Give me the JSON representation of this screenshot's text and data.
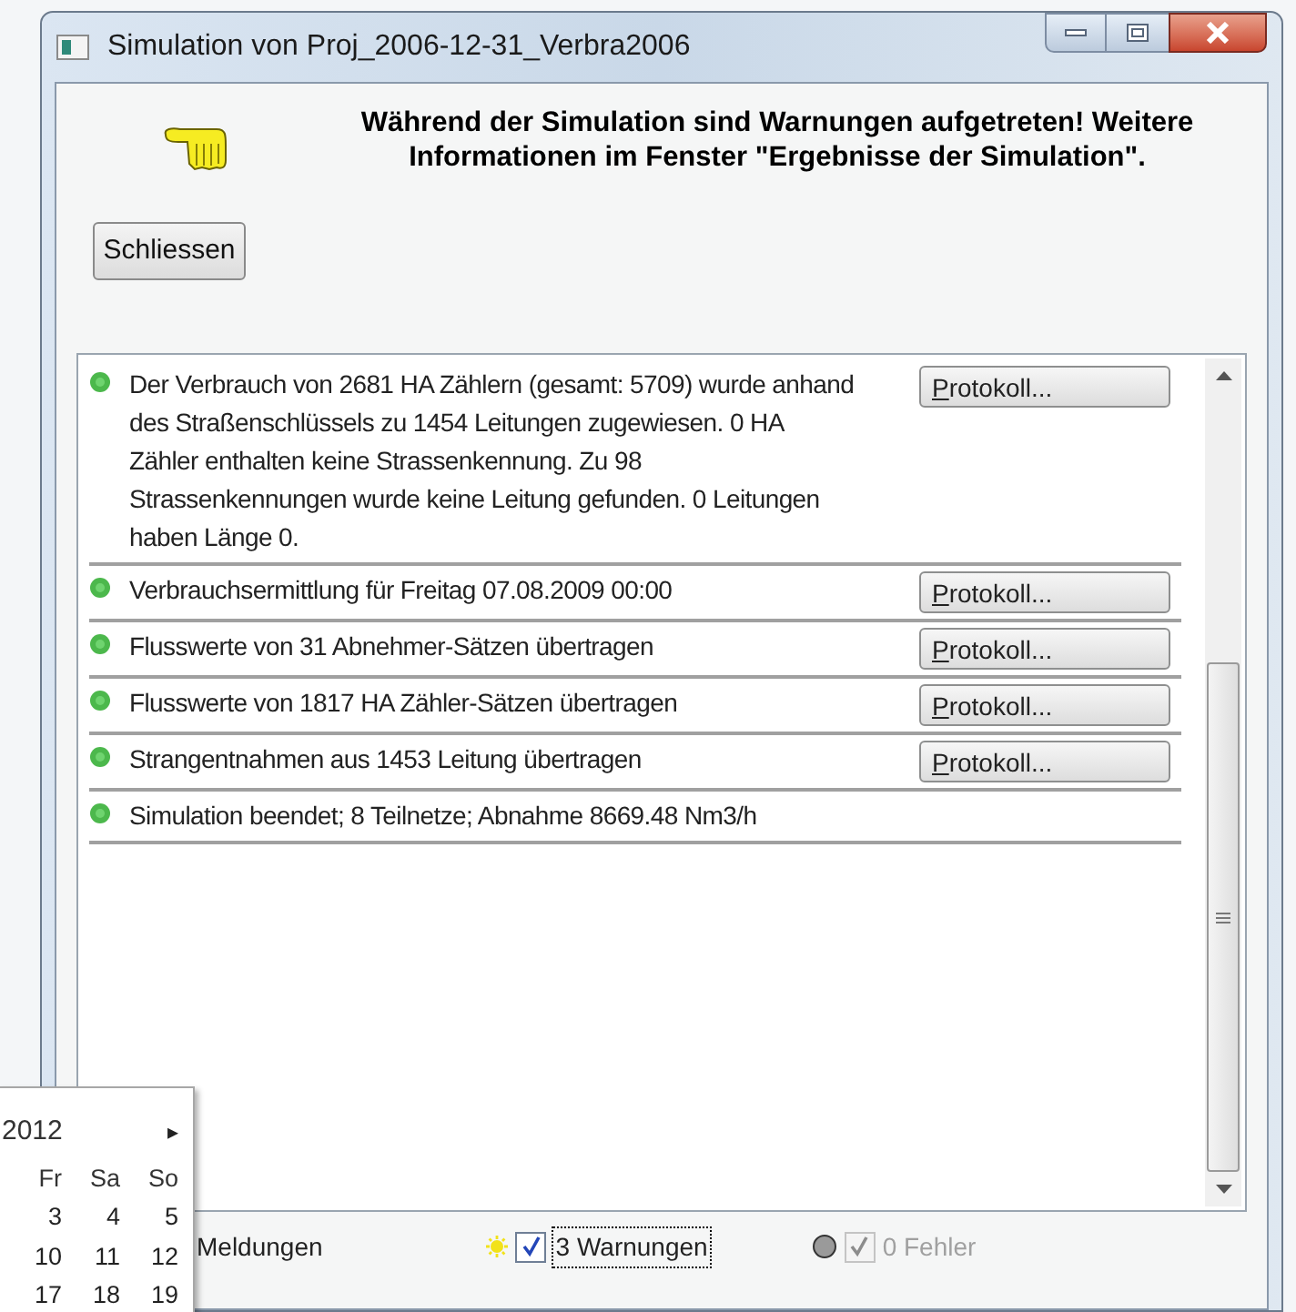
{
  "window": {
    "title": "Simulation von Proj_2006-12-31_Verbra2006"
  },
  "message": "Während der Simulation sind Warnungen aufgetreten! Weitere Informationen im Fenster \"Ergebnisse der Simulation\".",
  "close_button": "Schliessen",
  "messages": [
    {
      "text": "Der Verbrauch von 2681 HA Zählern (gesamt: 5709) wurde anhand des Straßenschlüssels zu 1454 Leitungen zugewiesen. 0 HA Zähler enthalten keine Strassenkennung. Zu 98 Strassenkennungen wurde keine Leitung gefunden. 0 Leitungen haben Länge 0.",
      "button": "Protokoll..."
    },
    {
      "text": "Verbrauchsermittlung für Freitag 07.08.2009 00:00",
      "button": "Protokoll..."
    },
    {
      "text": "Flusswerte von 31 Abnehmer-Sätzen übertragen",
      "button": "Protokoll..."
    },
    {
      "text": "Flusswerte von 1817 HA Zähler-Sätzen übertragen",
      "button": "Protokoll..."
    },
    {
      "text": "Strangentnahmen aus 1453 Leitung übertragen",
      "button": "Protokoll..."
    },
    {
      "text": "Simulation beendet; 8 Teilnetze; Abnahme 8669.48 Nm3/h"
    }
  ],
  "filters": [
    {
      "kind": "info",
      "label": "Meldungen"
    },
    {
      "kind": "warning",
      "label": "3 Warnungen",
      "checked": true,
      "disabled": false,
      "focused": true
    },
    {
      "kind": "error",
      "label": "0 Fehler",
      "checked": true,
      "disabled": true,
      "focused": false
    }
  ],
  "calendar": {
    "header": "2012",
    "next": "▸",
    "weekdays": [
      "Fr",
      "Sa",
      "So"
    ],
    "weeks": [
      [
        "3",
        "4",
        "5"
      ],
      [
        "10",
        "11",
        "12"
      ],
      [
        "17",
        "18",
        "19"
      ]
    ]
  }
}
